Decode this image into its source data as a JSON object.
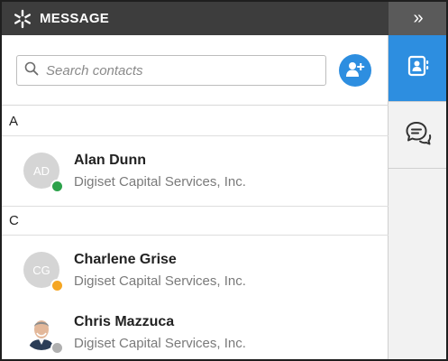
{
  "header": {
    "title": "MESSAGE",
    "collapse_glyph": "»"
  },
  "search": {
    "placeholder": "Search contacts",
    "value": ""
  },
  "sections": [
    {
      "letter": "A"
    },
    {
      "letter": "C"
    }
  ],
  "contacts": [
    {
      "initials": "AD",
      "name": "Alan Dunn",
      "company": "Digiset Capital Services, Inc.",
      "status": "online"
    },
    {
      "initials": "CG",
      "name": "Charlene Grise",
      "company": "Digiset Capital Services, Inc.",
      "status": "away"
    },
    {
      "initials": "",
      "name": "Chris Mazzuca",
      "company": "Digiset Capital Services, Inc.",
      "status": "offline"
    }
  ],
  "rail": {
    "tabs": [
      {
        "icon": "contacts-card-icon",
        "active": true
      },
      {
        "icon": "chat-bubbles-icon",
        "active": false
      }
    ]
  },
  "colors": {
    "accent": "#2d8ee0",
    "header_bg": "#3d3d3d",
    "online": "#2ca24a",
    "away": "#f5a623",
    "offline": "#b0b0b0"
  }
}
